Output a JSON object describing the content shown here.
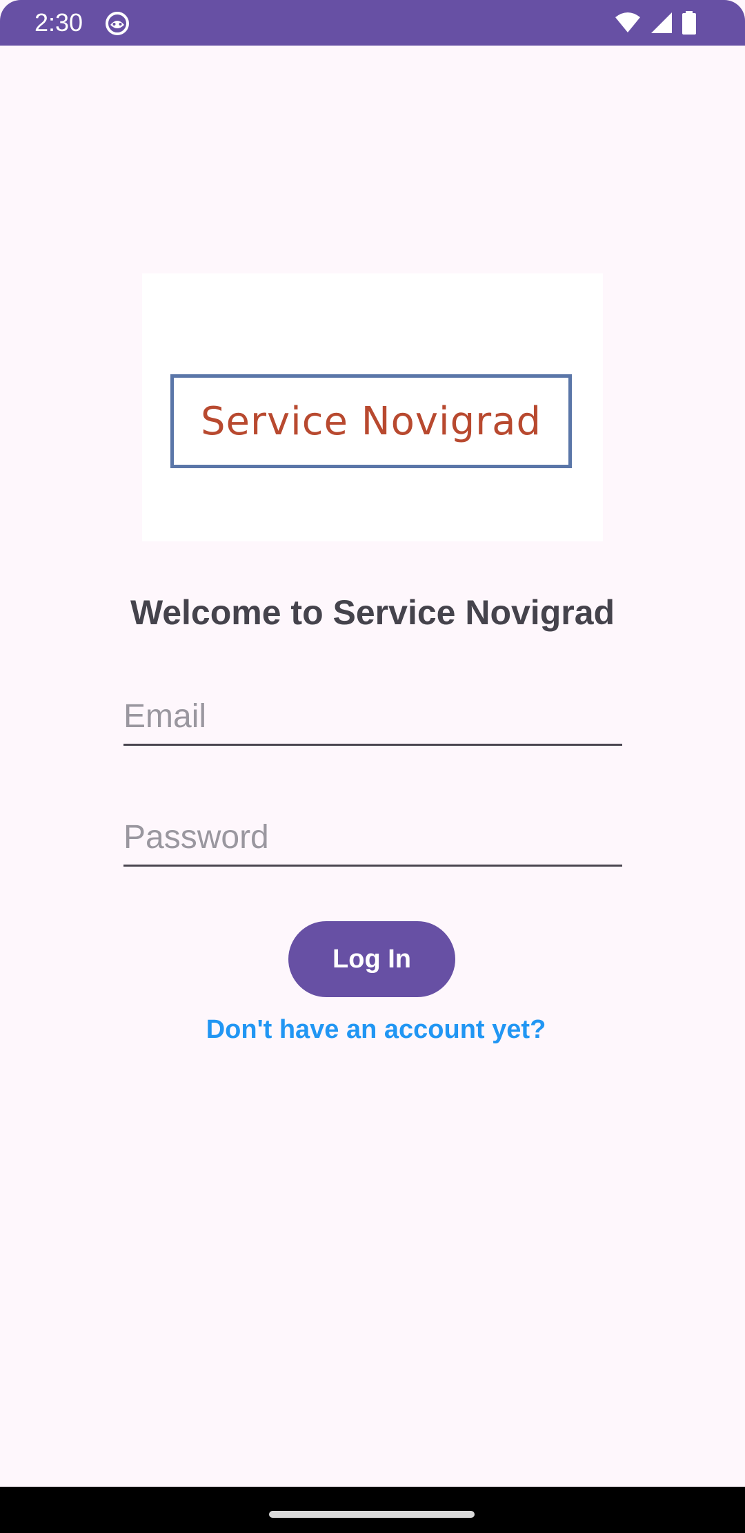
{
  "status_bar": {
    "time": "2:30",
    "background_color": "#6750A4",
    "icons": [
      "android-face-icon",
      "wifi-icon",
      "cell-signal-icon",
      "battery-icon"
    ]
  },
  "logo": {
    "text": "Service Novigrad",
    "text_color": "#B8492F",
    "frame_color": "#5A76A8"
  },
  "welcome_heading": "Welcome to Service Novigrad",
  "form": {
    "email_placeholder": "Email",
    "email_value": "",
    "password_placeholder": "Password",
    "password_value": "",
    "login_button_label": "Log In",
    "signup_link_text": "Don't have an account yet?"
  },
  "colors": {
    "accent": "#6750A4",
    "link": "#2196F3",
    "background": "#FEF7FC"
  }
}
